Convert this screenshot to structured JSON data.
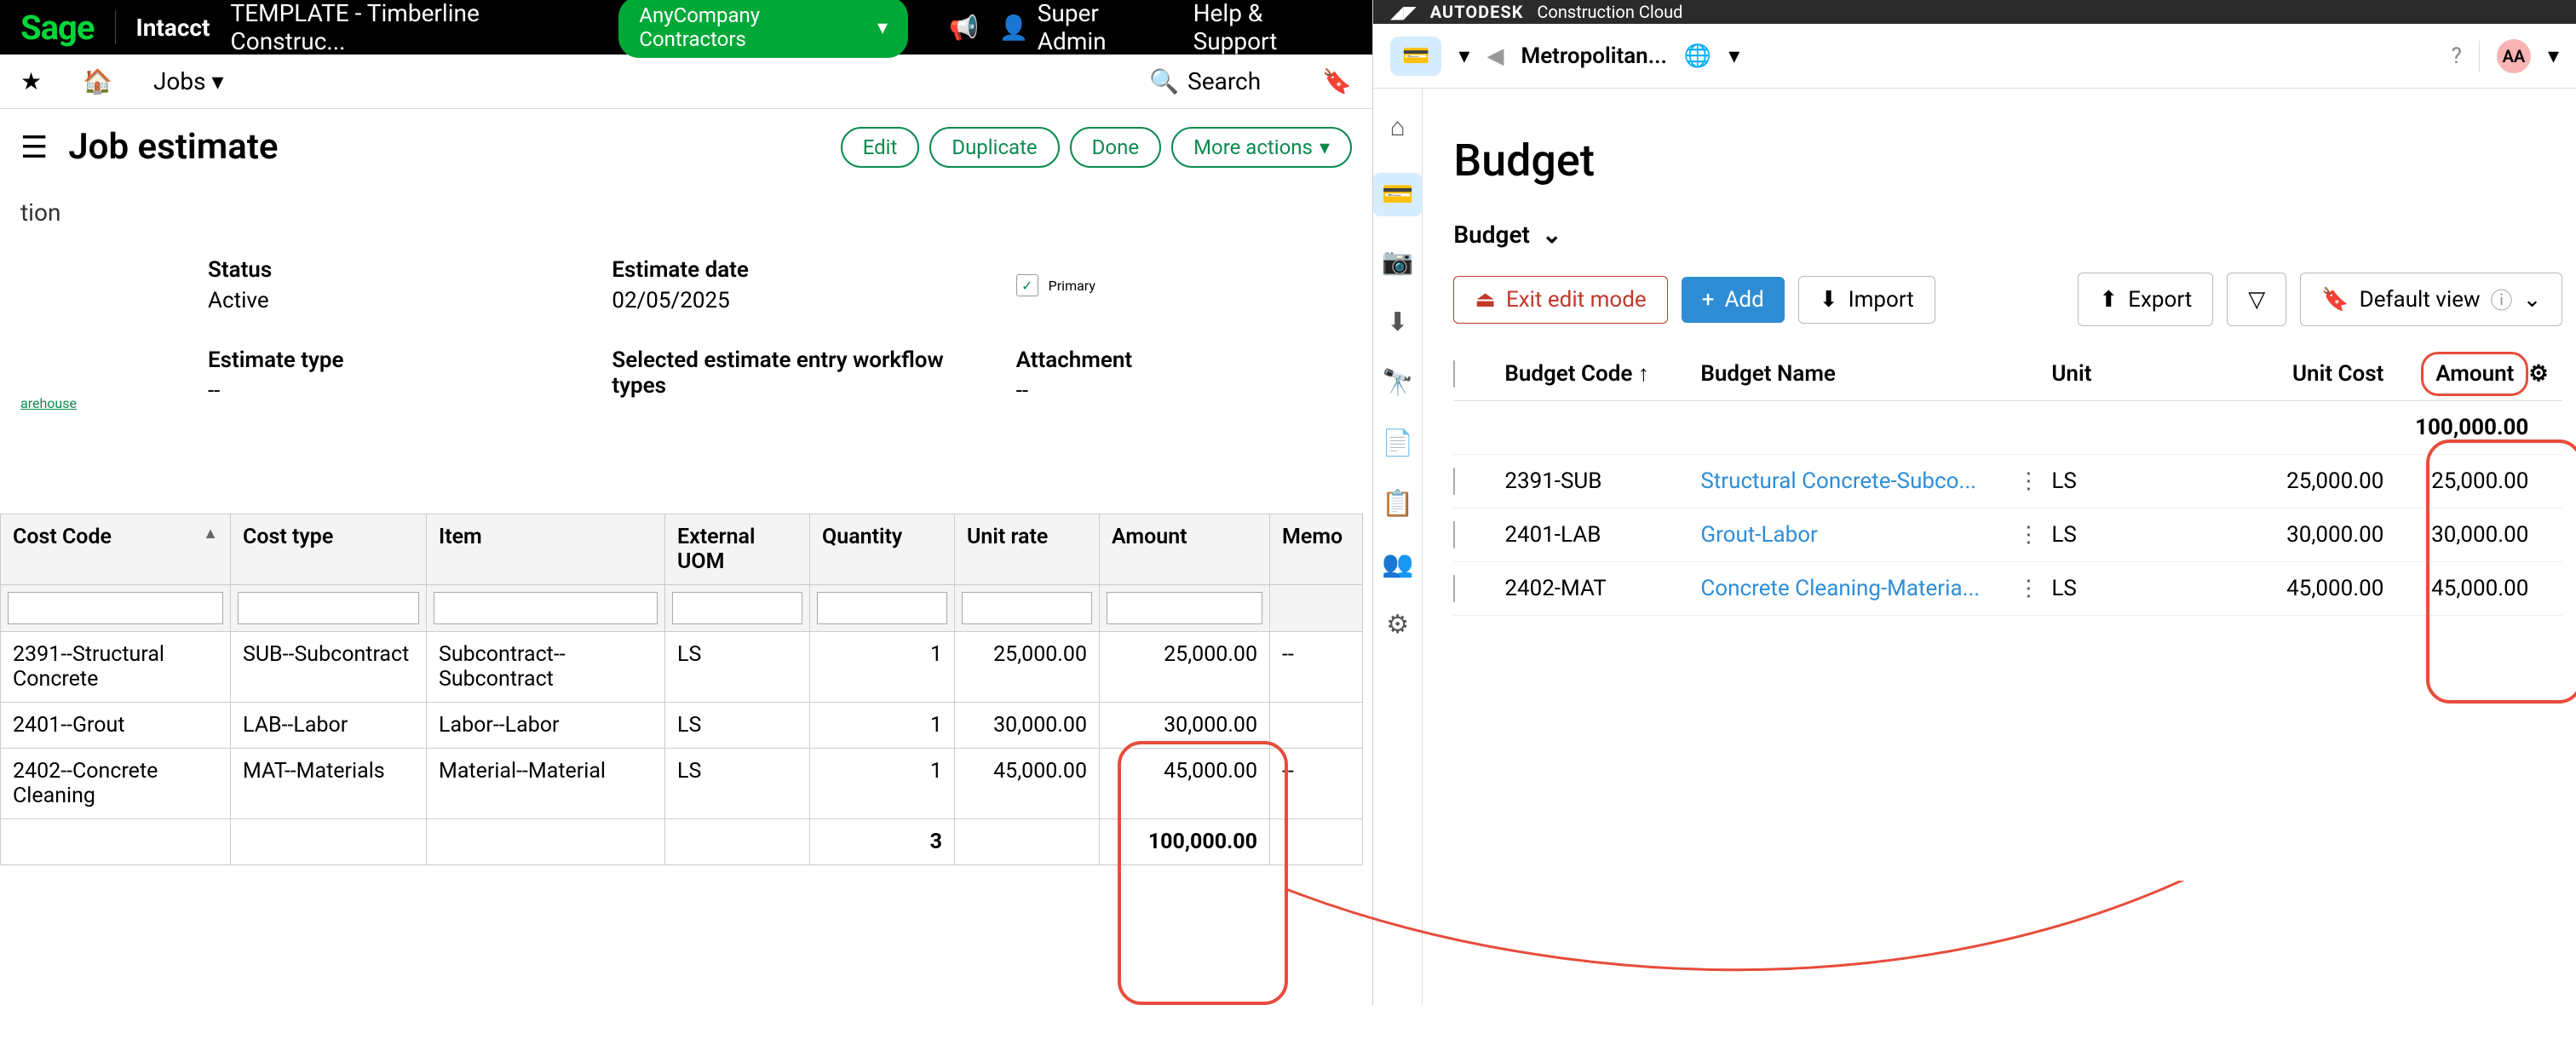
{
  "sage": {
    "logo": "Sage",
    "product": "Intacct",
    "company": "TEMPLATE - Timberline Construc...",
    "pill": "AnyCompany Contractors",
    "user": "Super Admin",
    "help": "Help & Support",
    "nav_jobs": "Jobs",
    "search": "Search",
    "page_title": "Job estimate",
    "actions": {
      "edit": "Edit",
      "duplicate": "Duplicate",
      "done": "Done",
      "more": "More actions"
    },
    "tion": "tion",
    "status_lbl": "Status",
    "status_val": "Active",
    "date_lbl": "Estimate date",
    "date_val": "02/05/2025",
    "primary": "Primary",
    "etype_lbl": "Estimate type",
    "etype_val": "--",
    "workflow_lbl": "Selected estimate entry workflow types",
    "attach_lbl": "Attachment",
    "attach_val": "--",
    "warehouse": "arehouse",
    "cols": {
      "cost_code": "Cost Code",
      "cost_type": "Cost type",
      "item": "Item",
      "uom": "External UOM",
      "qty": "Quantity",
      "rate": "Unit rate",
      "amount": "Amount",
      "memo": "Memo"
    },
    "rows": [
      {
        "code": "2391--Structural Concrete",
        "type": "SUB--Subcontract",
        "item": "Subcontract--Subcontract",
        "uom": "LS",
        "qty": "1",
        "rate": "25,000.00",
        "amt": "25,000.00",
        "memo": "--"
      },
      {
        "code": "2401--Grout",
        "type": "LAB--Labor",
        "item": "Labor--Labor",
        "uom": "LS",
        "qty": "1",
        "rate": "30,000.00",
        "amt": "30,000.00",
        "memo": ""
      },
      {
        "code": "2402--Concrete Cleaning",
        "type": "MAT--Materials",
        "item": "Material--Material",
        "uom": "LS",
        "qty": "1",
        "rate": "45,000.00",
        "amt": "45,000.00",
        "memo": "--"
      }
    ],
    "total_qty": "3",
    "total_amt": "100,000.00"
  },
  "adsk": {
    "brand_b": "AUTODESK",
    "brand": "Construction Cloud",
    "project": "Metropolitan...",
    "avatar": "AA",
    "title": "Budget",
    "crumb": "Budget",
    "btn": {
      "exit": "Exit edit mode",
      "add": "Add",
      "import": "Import",
      "export": "Export",
      "view": "Default view"
    },
    "cols": {
      "code": "Budget Code",
      "name": "Budget Name",
      "unit": "Unit",
      "unitcost": "Unit Cost",
      "amount": "Amount"
    },
    "total": "100,000.00",
    "rows": [
      {
        "code": "2391-SUB",
        "name": "Structural Concrete-Subco...",
        "unit": "LS",
        "cost": "25,000.00",
        "amt": "25,000.00"
      },
      {
        "code": "2401-LAB",
        "name": "Grout-Labor",
        "unit": "LS",
        "cost": "30,000.00",
        "amt": "30,000.00"
      },
      {
        "code": "2402-MAT",
        "name": "Concrete Cleaning-Materia...",
        "unit": "LS",
        "cost": "45,000.00",
        "amt": "45,000.00"
      }
    ]
  }
}
